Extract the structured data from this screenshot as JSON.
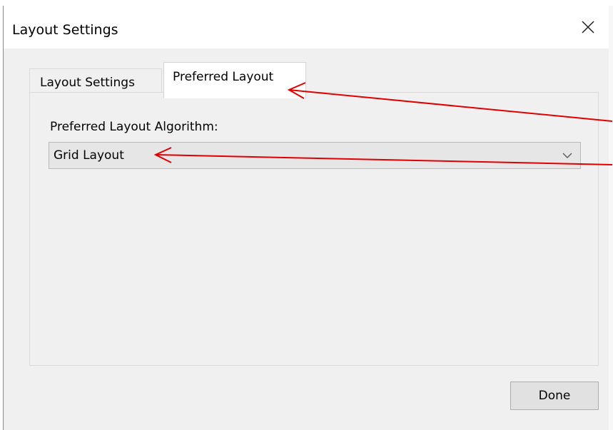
{
  "window": {
    "title": "Layout Settings"
  },
  "tabs": [
    {
      "label": "Layout Settings",
      "active": false
    },
    {
      "label": "Preferred Layout",
      "active": true
    }
  ],
  "preferred_layout": {
    "field_label": "Preferred Layout Algorithm:",
    "selected_value": "Grid Layout"
  },
  "buttons": {
    "done_label": "Done"
  },
  "annotations": {
    "arrow_color": "#e00000"
  },
  "icons": {
    "close": "close-icon",
    "dropdown": "chevron-down-icon"
  }
}
